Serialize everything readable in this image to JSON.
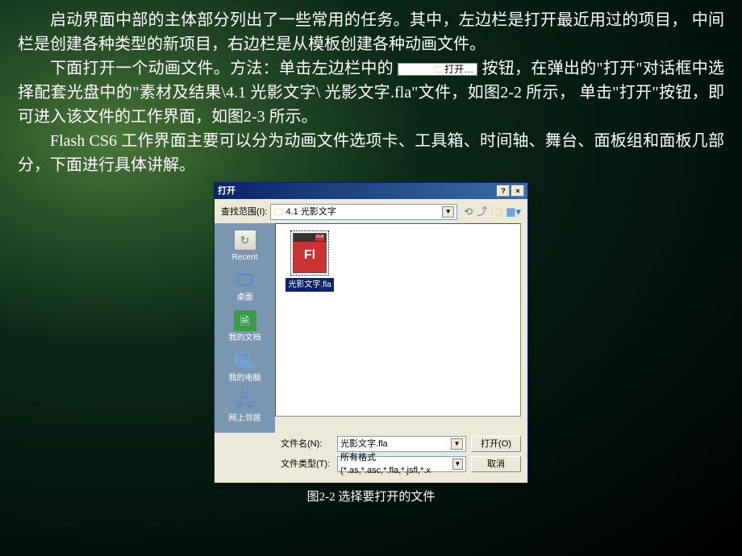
{
  "paragraphs": {
    "p1": "启动界面中部的主体部分列出了一些常用的任务。其中，左边栏是打开最近用过的项目，  中间栏是创建各种类型的新项目，右边栏是从模板创建各种动画文件。",
    "p2a": "下面打开一个动画文件。方法：单击左边栏中的 ",
    "inline_button_label": "打开…",
    "p2b": " 按钮，在弹出的\"打开\"对话框中选择配套光盘中的\"素材及结果\\4.1 光影文字\\ 光影文字.fla\"文件，如图2-2 所示，  单击\"打开\"按钮，即可进入该文件的工作界面，如图2-3 所示。",
    "p3": "Flash CS6 工作界面主要可以分为动画文件选项卡、工具箱、时间轴、舞台、面板组和面板几部分，下面进行具体讲解。"
  },
  "dialog": {
    "title": "打开",
    "help_btn": "?",
    "close_btn": "×",
    "lookup_label": "查找范围(I):",
    "lookup_value": "4.1  光影文字",
    "sidebar": [
      {
        "label": "Recent"
      },
      {
        "label": "桌面"
      },
      {
        "label": "我的文档"
      },
      {
        "label": "我的电脑"
      },
      {
        "label": "网上邻居"
      }
    ],
    "file": {
      "thumb_badge": "FLA",
      "thumb_text": "Fl",
      "label": "光影文字.fla"
    },
    "filename_label": "文件名(N):",
    "filename_value": "光影文字.fla",
    "filetype_label": "文件类型(T):",
    "filetype_value": "所有格式 (*.as,*.asc,*.fla,*.jsfl,*.x",
    "open_btn": "打开(O)",
    "cancel_btn": "取消"
  },
  "caption": "图2-2   选择要打开的文件"
}
